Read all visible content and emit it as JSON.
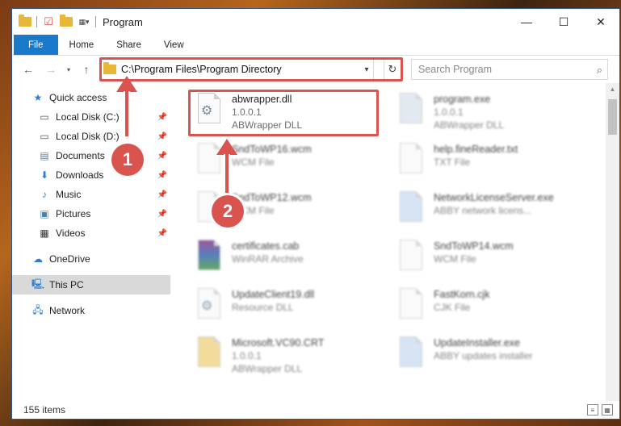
{
  "window": {
    "title": "Program"
  },
  "ribbon": {
    "tabs": [
      "File",
      "Home",
      "Share",
      "View"
    ]
  },
  "address": {
    "path": "C:\\Program Files\\Program Directory"
  },
  "search": {
    "placeholder": "Search Program"
  },
  "nav": {
    "quick_access": "Quick access",
    "quick_items": [
      "Local Disk (C:)",
      "Local Disk (D:)",
      "Documents",
      "Downloads",
      "Music",
      "Pictures",
      "Videos"
    ],
    "onedrive": "OneDrive",
    "thispc": "This PC",
    "network": "Network"
  },
  "files": [
    {
      "name": "abwrapper.dll",
      "line2": "1.0.0.1",
      "line3": "ABWrapper DLL"
    },
    {
      "name": "program.exe",
      "line2": "1.0.0.1",
      "line3": "ABWrapper DLL"
    },
    {
      "name": "SndToWP16.wcm",
      "line2": "WCM File",
      "line3": ""
    },
    {
      "name": "help.fineReader.txt",
      "line2": "TXT File",
      "line3": ""
    },
    {
      "name": "SndToWP12.wcm",
      "line2": "WCM File",
      "line3": ""
    },
    {
      "name": "NetworkLicenseServer.exe",
      "line2": "ABBY network licens...",
      "line3": ""
    },
    {
      "name": "certificates.cab",
      "line2": "WinRAR Archive",
      "line3": ""
    },
    {
      "name": "SndToWP14.wcm",
      "line2": "WCM File",
      "line3": ""
    },
    {
      "name": "UpdateClient19.dll",
      "line2": "Resource DLL",
      "line3": ""
    },
    {
      "name": "FastKorn.cjk",
      "line2": "CJK File",
      "line3": ""
    },
    {
      "name": "Microsoft.VC90.CRT",
      "line2": "1.0.0.1",
      "line3": "ABWrapper DLL"
    },
    {
      "name": "UpdateInstaller.exe",
      "line2": "ABBY updates installer",
      "line3": ""
    }
  ],
  "callouts": [
    "1",
    "2"
  ],
  "status": {
    "items": "155 items"
  },
  "colors": {
    "accent": "#1979ca",
    "highlight": "#d9534f"
  }
}
